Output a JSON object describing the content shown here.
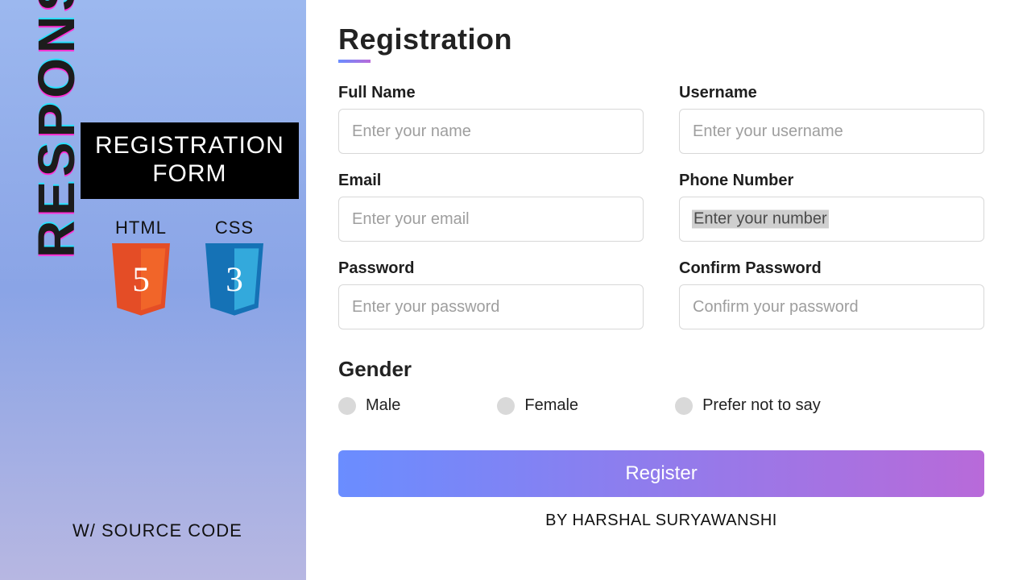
{
  "left": {
    "responsive": "RESPONSIVE",
    "badge_line1": "REGISTRATION",
    "badge_line2": "FORM",
    "html_label": "HTML",
    "html_glyph": "5",
    "css_label": "CSS",
    "css_glyph": "3",
    "source_code": "W/ SOURCE CODE"
  },
  "form": {
    "title": "Registration",
    "fields": [
      {
        "label": "Full Name",
        "placeholder": "Enter your name"
      },
      {
        "label": "Username",
        "placeholder": "Enter your username"
      },
      {
        "label": "Email",
        "placeholder": "Enter your email"
      },
      {
        "label": "Phone Number",
        "placeholder": "Enter your number",
        "highlight": true
      },
      {
        "label": "Password",
        "placeholder": "Enter your password"
      },
      {
        "label": "Confirm Password",
        "placeholder": "Confirm your password"
      }
    ],
    "gender_title": "Gender",
    "gender_options": [
      "Male",
      "Female",
      "Prefer not to say"
    ],
    "submit": "Register",
    "byline": "BY HARSHAL SURYAWANSHI"
  }
}
